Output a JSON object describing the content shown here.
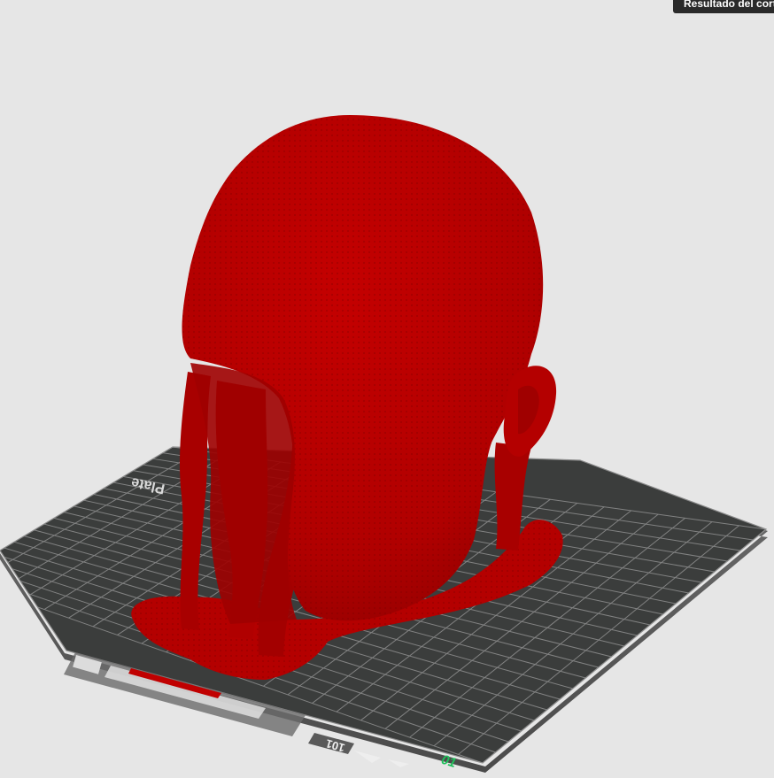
{
  "window": {
    "tooltip": "Resultado del corte"
  },
  "viewport": {
    "background": "#e6e6e6",
    "plate": {
      "label": "Plate",
      "number": "01",
      "index_badge": "101",
      "surface_color": "#3b3d3c",
      "grid_color": "#9a9a9a",
      "number_color": "#1fbf5a"
    },
    "model": {
      "name": "head with supports",
      "color": "#b80000",
      "shade_color": "#8f0000"
    }
  }
}
